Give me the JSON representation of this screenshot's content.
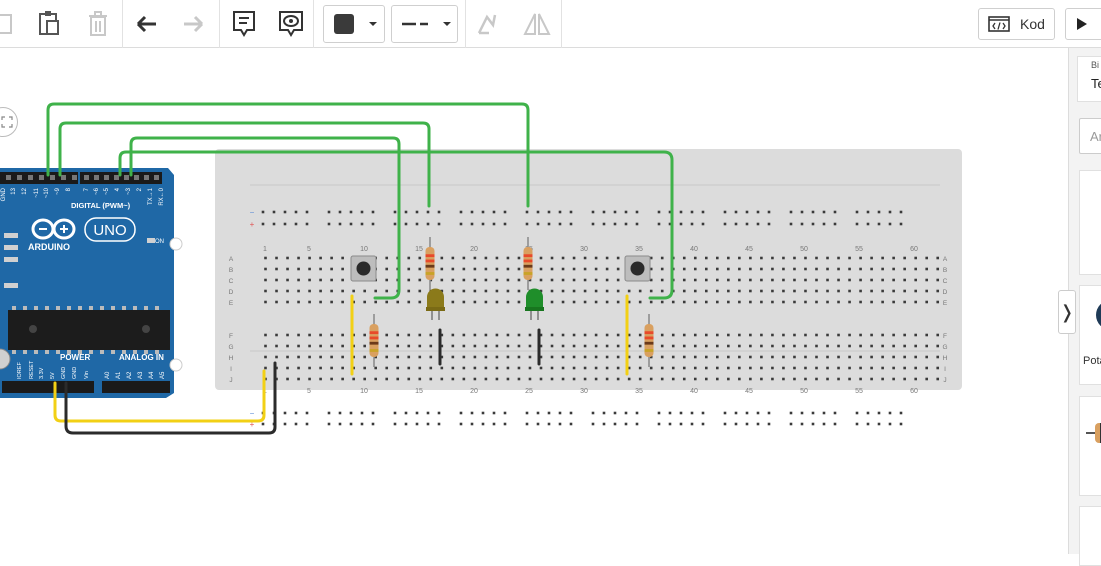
{
  "toolbar": {
    "items": [
      {
        "name": "copy-icon"
      },
      {
        "name": "paste-icon"
      },
      {
        "name": "delete-icon"
      },
      {
        "name": "undo-icon"
      },
      {
        "name": "redo-icon"
      },
      {
        "name": "notes-icon"
      },
      {
        "name": "notes-visibility-icon"
      },
      {
        "name": "color-picker-icon"
      },
      {
        "name": "line-style-icon"
      },
      {
        "name": "rotate-icon"
      },
      {
        "name": "mirror-icon"
      }
    ],
    "code_label": "Kod",
    "code_icon": "code-icon",
    "play_icon": "play-icon",
    "fill_color": "#3a3a3a"
  },
  "right_panel": {
    "select_label": "Bi",
    "select_value": "Te",
    "search_placeholder": "Ar",
    "component_label": "Pota"
  },
  "arduino": {
    "brand": "ARDUINO",
    "model": "UNO",
    "digital_label": "DIGITAL (PWM~)",
    "power_label": "POWER",
    "analog_label": "ANALOG IN",
    "on_label": "ON",
    "digital_pins": [
      "GND",
      "13",
      "12",
      "~11",
      "~10",
      "~9",
      "8",
      "7",
      "~6",
      "~5",
      "4",
      "~3",
      "2",
      "TX→1",
      "RX←0"
    ],
    "power_pins": [
      "IOREF",
      "RESET",
      "3.3V",
      "5V",
      "GND",
      "GND",
      "Vin"
    ],
    "analog_pins": [
      "A0",
      "A1",
      "A2",
      "A3",
      "A4",
      "A5"
    ],
    "board_color": "#1f68a6"
  },
  "breadboard": {
    "column_numbers": [
      "1",
      "5",
      "10",
      "15",
      "20",
      "25",
      "30",
      "35",
      "40",
      "45",
      "50",
      "55",
      "60"
    ],
    "row_letters_top": [
      "A",
      "B",
      "C",
      "D",
      "E"
    ],
    "row_letters_bottom": [
      "F",
      "G",
      "H",
      "I",
      "J"
    ],
    "rail_minus": "−",
    "rail_plus": "+"
  },
  "colors": {
    "wire_green": "#3fb24a",
    "wire_yellow": "#f2d015",
    "wire_black": "#2b2b2b",
    "led_yellow": "#8b7a1a",
    "led_green": "#1f8e2a"
  }
}
